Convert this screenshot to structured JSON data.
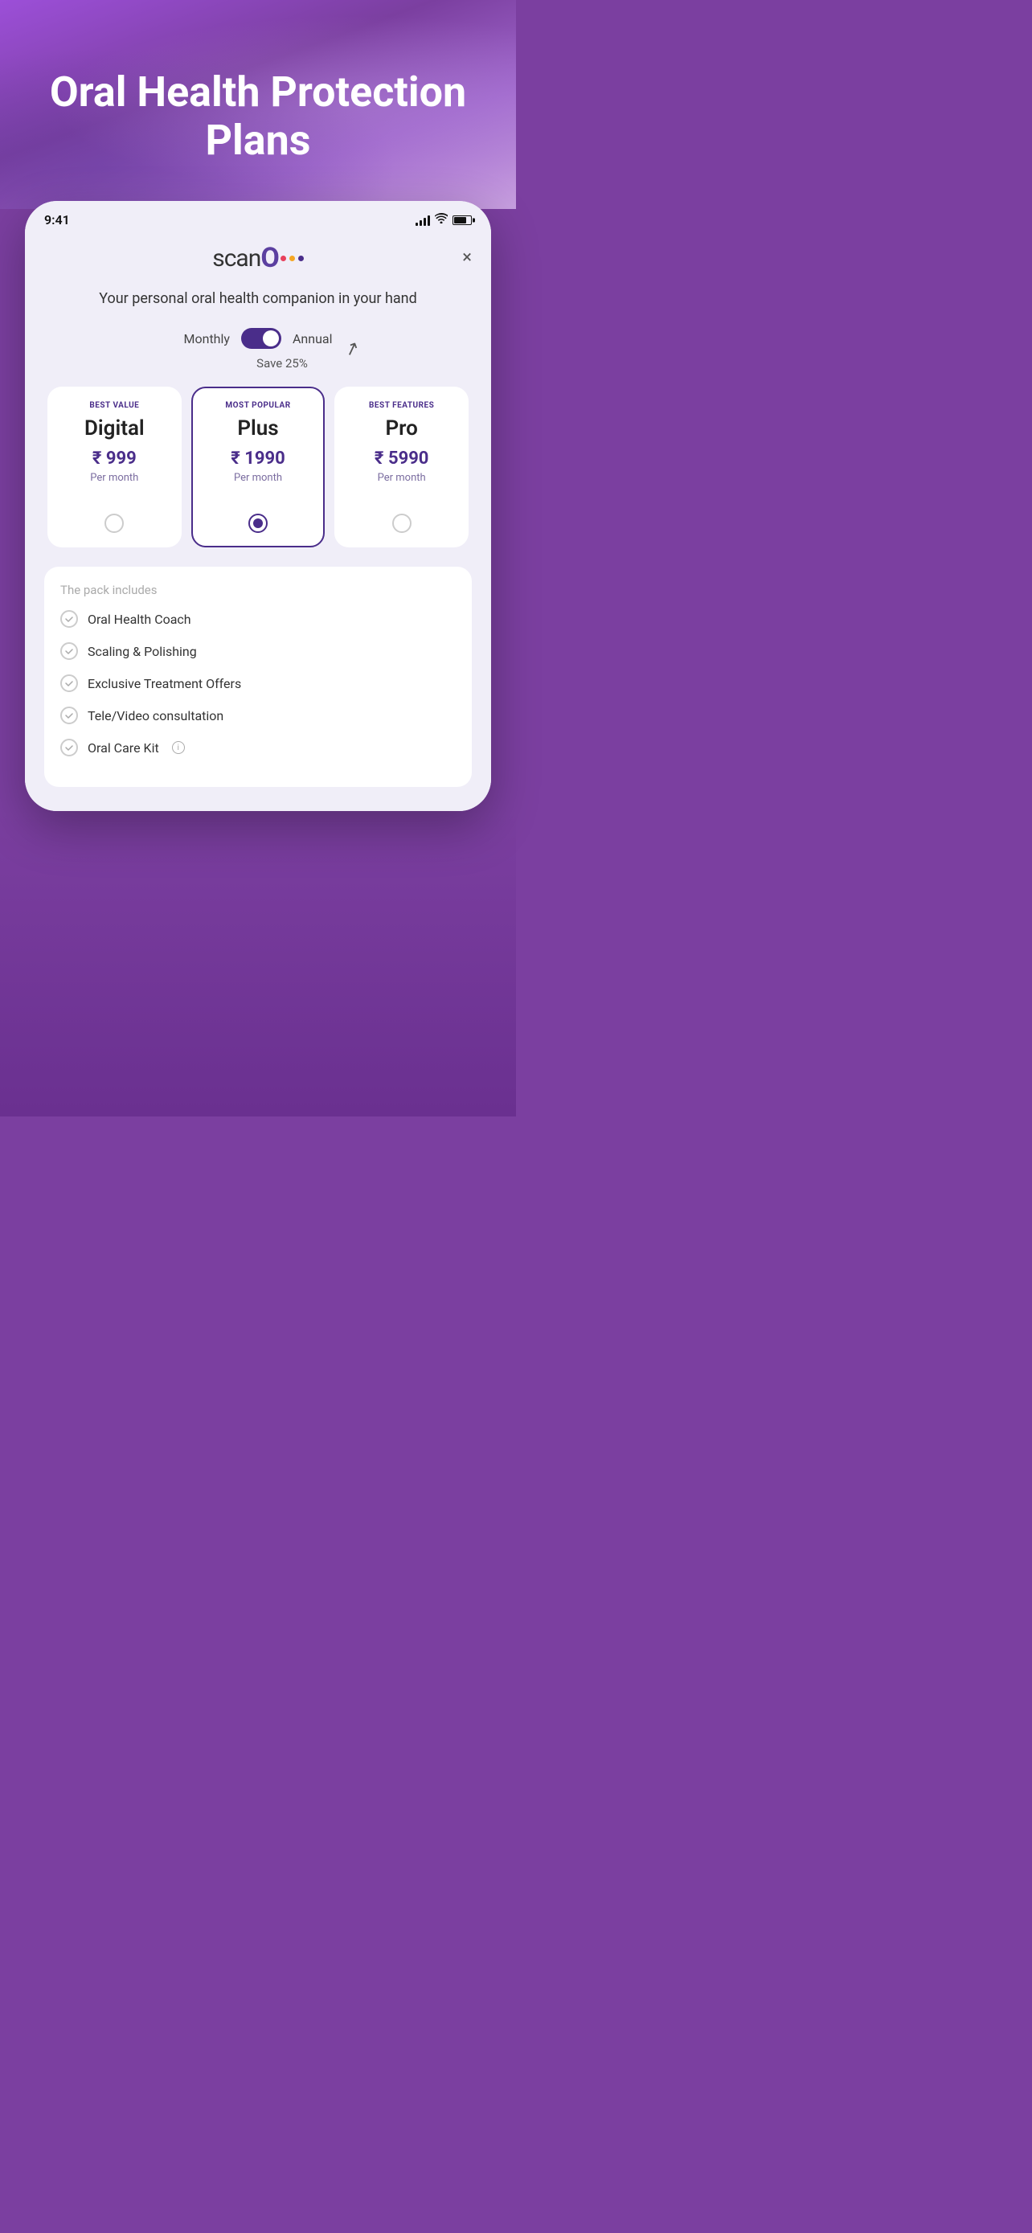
{
  "hero": {
    "title": "Oral Health Protection Plans"
  },
  "statusBar": {
    "time": "9:41",
    "batteryPercent": 75
  },
  "modal": {
    "closeLabel": "×",
    "logo": {
      "scanText": "scan",
      "oText": "O",
      "dots": [
        "#e83f5b",
        "#f5a623",
        "#4a2d8a"
      ]
    },
    "tagline": "Your personal oral health companion in your hand",
    "toggle": {
      "monthlyLabel": "Monthly",
      "annualLabel": "Annual",
      "isAnnual": true
    },
    "saveHint": {
      "text": "Save 25%"
    },
    "plans": [
      {
        "id": "digital",
        "badge": "BEST VALUE",
        "name": "Digital",
        "price": "₹ 999",
        "period": "Per month",
        "selected": false
      },
      {
        "id": "plus",
        "badge": "MOST POPULAR",
        "name": "Plus",
        "price": "₹ 1990",
        "period": "Per month",
        "selected": true
      },
      {
        "id": "pro",
        "badge": "BEST FEATURES",
        "name": "Pro",
        "price": "₹ 5990",
        "period": "Per month",
        "selected": false
      }
    ],
    "features": {
      "sectionTitle": "The pack includes",
      "items": [
        {
          "text": "Oral Health Coach",
          "hasInfo": false
        },
        {
          "text": "Scaling & Polishing",
          "hasInfo": false
        },
        {
          "text": "Exclusive Treatment Offers",
          "hasInfo": false
        },
        {
          "text": "Tele/Video consultation",
          "hasInfo": false
        },
        {
          "text": "Oral Care Kit",
          "hasInfo": true
        }
      ]
    }
  }
}
